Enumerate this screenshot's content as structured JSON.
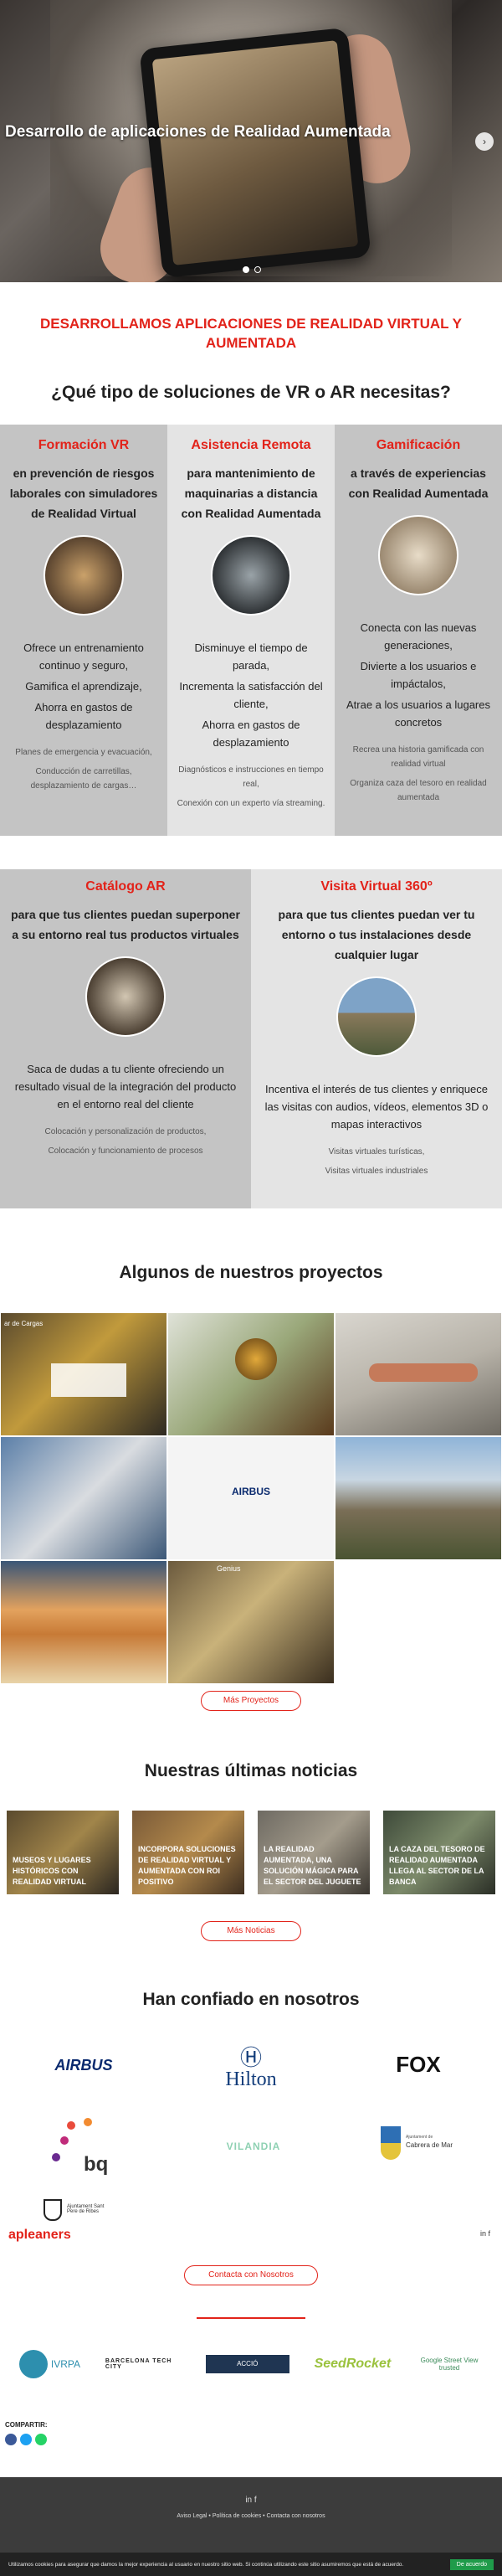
{
  "hero": {
    "title": "Desarrollo de aplicaciones de Realidad Aumentada",
    "next_icon": "›"
  },
  "intro": {
    "heading": "DESARROLLAMOS APLICACIONES DE REALIDAD VIRTUAL Y AUMENTADA"
  },
  "question": "¿Qué tipo de soluciones de VR o AR necesitas?",
  "solutions": [
    {
      "title": "Formación VR",
      "subtitle": "en prevención de riesgos laborales con simuladores de Realidad Virtual",
      "benefits": [
        "Ofrece un entrenamiento continuo y seguro,",
        "Gamifica el aprendizaje,",
        "Ahorra en gastos de desplazamiento"
      ],
      "uses": [
        "Planes de emergencia y evacuación,",
        "Conducción de carretillas, desplazamiento de cargas…"
      ]
    },
    {
      "title": "Asistencia Remota",
      "subtitle": "para mantenimiento de maquinarias a distancia con Realidad Aumentada",
      "benefits": [
        "Disminuye el tiempo de parada,",
        "Incrementa la satisfacción del cliente,",
        "Ahorra en gastos de desplazamiento"
      ],
      "uses": [
        "Diagnósticos e instrucciones en tiempo real,",
        "Conexión con un experto vía streaming."
      ]
    },
    {
      "title": "Gamificación",
      "subtitle": "a través de experiencias con Realidad Aumentada",
      "benefits": [
        "Conecta con las nuevas generaciones,",
        "Divierte a los usuarios e impáctalos,",
        "Atrae a los usuarios a lugares concretos"
      ],
      "uses": [
        "Recrea una historia gamificada con realidad virtual",
        "Organiza caza del tesoro en realidad aumentada"
      ]
    },
    {
      "title": "Catálogo AR",
      "subtitle": "para que tus clientes puedan superponer a su entorno real tus productos virtuales",
      "benefits": [
        "Saca de dudas a tu cliente ofreciendo un resultado visual de la integración del producto en el entorno real del cliente"
      ],
      "uses": [
        "Colocación y personalización de productos,",
        "Colocación y funcionamiento de procesos"
      ]
    },
    {
      "title": "Visita Virtual 360º",
      "subtitle": "para que tus clientes puedan ver tu entorno o tus instalaciones desde cualquier lugar",
      "benefits": [
        "Incentiva el interés de tus clientes y enriquece las visitas con audios, vídeos, elementos 3D o mapas interactivos"
      ],
      "uses": [
        "Visitas virtuales turísticas,",
        "Visitas virtuales industriales"
      ]
    }
  ],
  "projects": {
    "title": "Algunos de nuestros proyectos",
    "more_label": "Más Proyectos",
    "tiles": [
      "forklift",
      "bee",
      "anatomy",
      "warehouse",
      "airbus",
      "landscape",
      "beach",
      "gallery"
    ],
    "tile_texts": {
      "forklift_head": "ar de Cargas",
      "airbus_logo": "AIRBUS",
      "gallery_label": "Genius"
    }
  },
  "news": {
    "title": "Nuestras últimas noticias",
    "more_label": "Más Noticias",
    "items": [
      "MUSEOS Y LUGARES HISTÓRICOS CON REALIDAD VIRTUAL",
      "INCORPORA SOLUCIONES DE REALIDAD VIRTUAL Y AUMENTADA CON ROI POSITIVO",
      "LA REALIDAD AUMENTADA, UNA SOLUCIÓN MÁGICA PARA EL SECTOR DEL JUGUETE",
      "LA CAZA DEL TESORO DE REALIDAD AUMENTADA LLEGA AL SECTOR DE LA BANCA"
    ]
  },
  "clients": {
    "title": "Han confiado en nosotros",
    "airbus": "AIRBUS",
    "hilton": "Hilton",
    "fox": "FOX",
    "bq": "bq",
    "vilandia": "VILANDIA",
    "cabrera": "Cabrera de Mar",
    "cabrera_pre": "Ajuntament de",
    "sant_pere": "Ajuntament Sant Pere de Ribes",
    "apleaners": "apleaners",
    "social": "in  f"
  },
  "contact_label": "Contacta con Nosotros",
  "partners": {
    "ivrpa": "IVRPA",
    "bcn": "BARCELONA TECH CITY",
    "accio": "ACCIÓ",
    "seedrocket": "SeedRocket",
    "google": "Google Street View trusted"
  },
  "share_label": "COMPARTIR:",
  "footer": {
    "social": "in   f",
    "links": "Aviso Legal  •  Política de cookies  •  Contacta con nosotros"
  },
  "cookie": {
    "text": "Utilizamos cookies para asegurar que damos la mejor experiencia al usuario en nuestro sitio web. Si continúa utilizando este sitio asumiremos que está de acuerdo.",
    "accept": "De acuerdo"
  },
  "colors": {
    "accent": "#e2231a",
    "panel_dark": "#c4c4c4",
    "panel_light": "#e4e4e4"
  }
}
